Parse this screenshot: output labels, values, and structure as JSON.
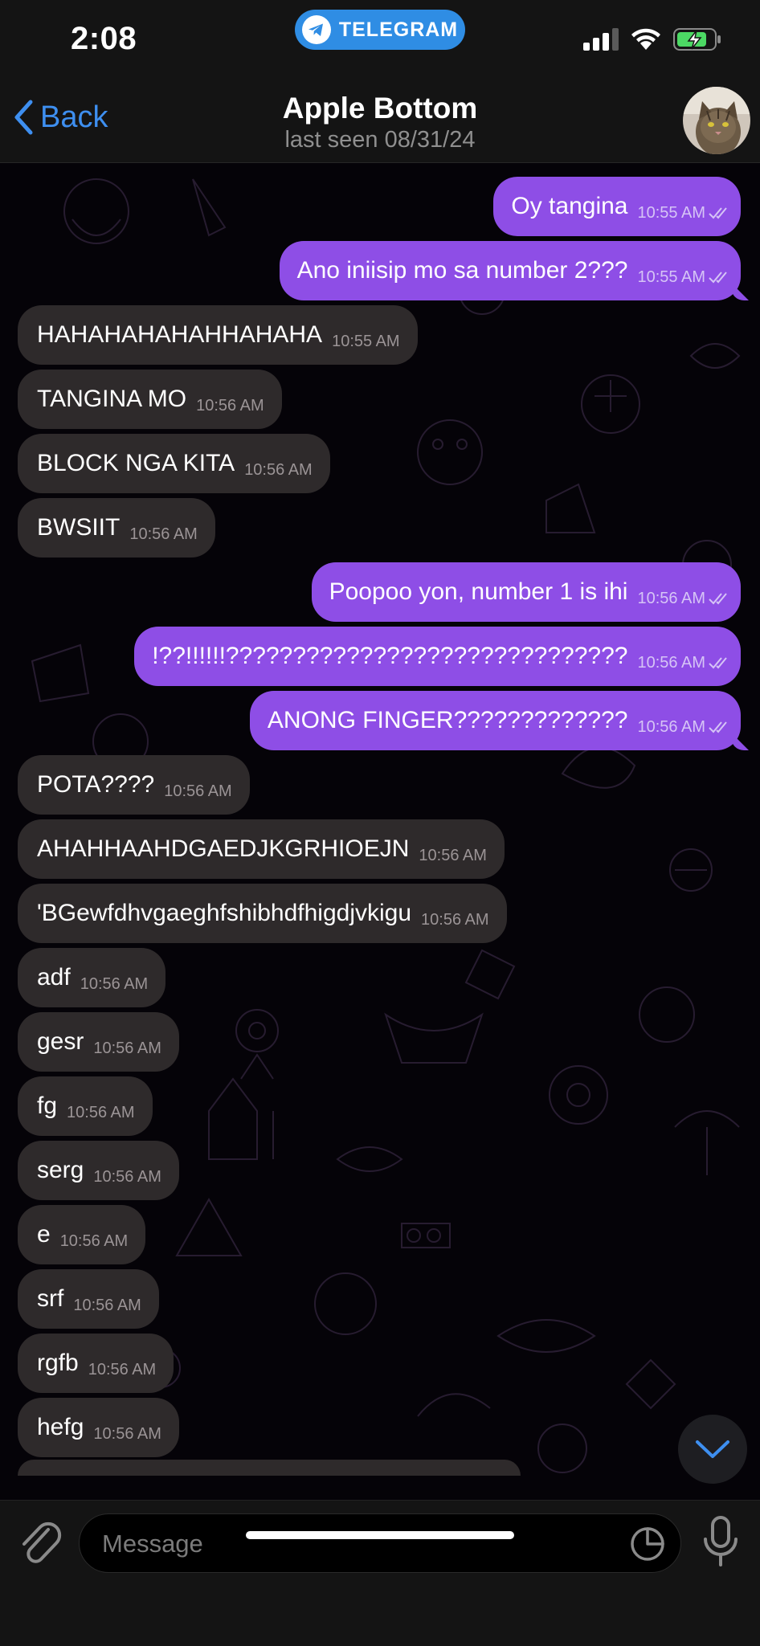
{
  "status": {
    "time": "2:08",
    "app_badge": "TELEGRAM",
    "icons": [
      "cellular-signal-icon",
      "wifi-icon",
      "battery-charging-icon"
    ],
    "colors": {
      "badge": "#2f8de4",
      "battery": "#4cd964"
    }
  },
  "header": {
    "back_label": "Back",
    "title": "Apple Bottom",
    "subtitle": "last seen 08/31/24"
  },
  "messages": [
    {
      "dir": "out",
      "text": "Oy tangina",
      "time": "10:55 AM"
    },
    {
      "dir": "out",
      "text": "Ano iniisip mo sa number 2???",
      "time": "10:55 AM"
    },
    {
      "dir": "in",
      "text": "HAHAHAHAHAHHAHAHA",
      "time": "10:55 AM"
    },
    {
      "dir": "in",
      "text": "TANGINA MO",
      "time": "10:56 AM"
    },
    {
      "dir": "in",
      "text": "BLOCK NGA KITA",
      "time": "10:56 AM"
    },
    {
      "dir": "in",
      "text": "BWSIIT",
      "time": "10:56 AM"
    },
    {
      "dir": "out",
      "text": "Poopoo yon, number 1 is ihi",
      "time": "10:56 AM"
    },
    {
      "dir": "out",
      "text": "!??!!!!!!??????????????????????????????",
      "time": "10:56 AM"
    },
    {
      "dir": "out",
      "text": "ANONG FINGER?????????????",
      "time": "10:56 AM"
    },
    {
      "dir": "in",
      "text": "POTA????",
      "time": "10:56 AM"
    },
    {
      "dir": "in",
      "text": "AHAHHAAHDGAEDJKGRHIOEJN",
      "time": "10:56 AM"
    },
    {
      "dir": "in",
      "text": "'BGewfdhvgaeghfshibhdfhigdjvkigu",
      "time": "10:56 AM"
    },
    {
      "dir": "in",
      "text": "adf",
      "time": "10:56 AM"
    },
    {
      "dir": "in",
      "text": "gesr",
      "time": "10:56 AM"
    },
    {
      "dir": "in",
      "text": "fg",
      "time": "10:56 AM"
    },
    {
      "dir": "in",
      "text": "serg",
      "time": "10:56 AM"
    },
    {
      "dir": "in",
      "text": "e",
      "time": "10:56 AM"
    },
    {
      "dir": "in",
      "text": "srf",
      "time": "10:56 AM"
    },
    {
      "dir": "in",
      "text": "rgfb",
      "time": "10:56 AM"
    },
    {
      "dir": "in",
      "text": "hefg",
      "time": "10:56 AM"
    }
  ],
  "composer": {
    "placeholder": "Message"
  },
  "theme": {
    "outgoing_bubble": "#8e4ee6",
    "incoming_bubble": "#2e2a2b",
    "accent": "#3e8ff0"
  }
}
